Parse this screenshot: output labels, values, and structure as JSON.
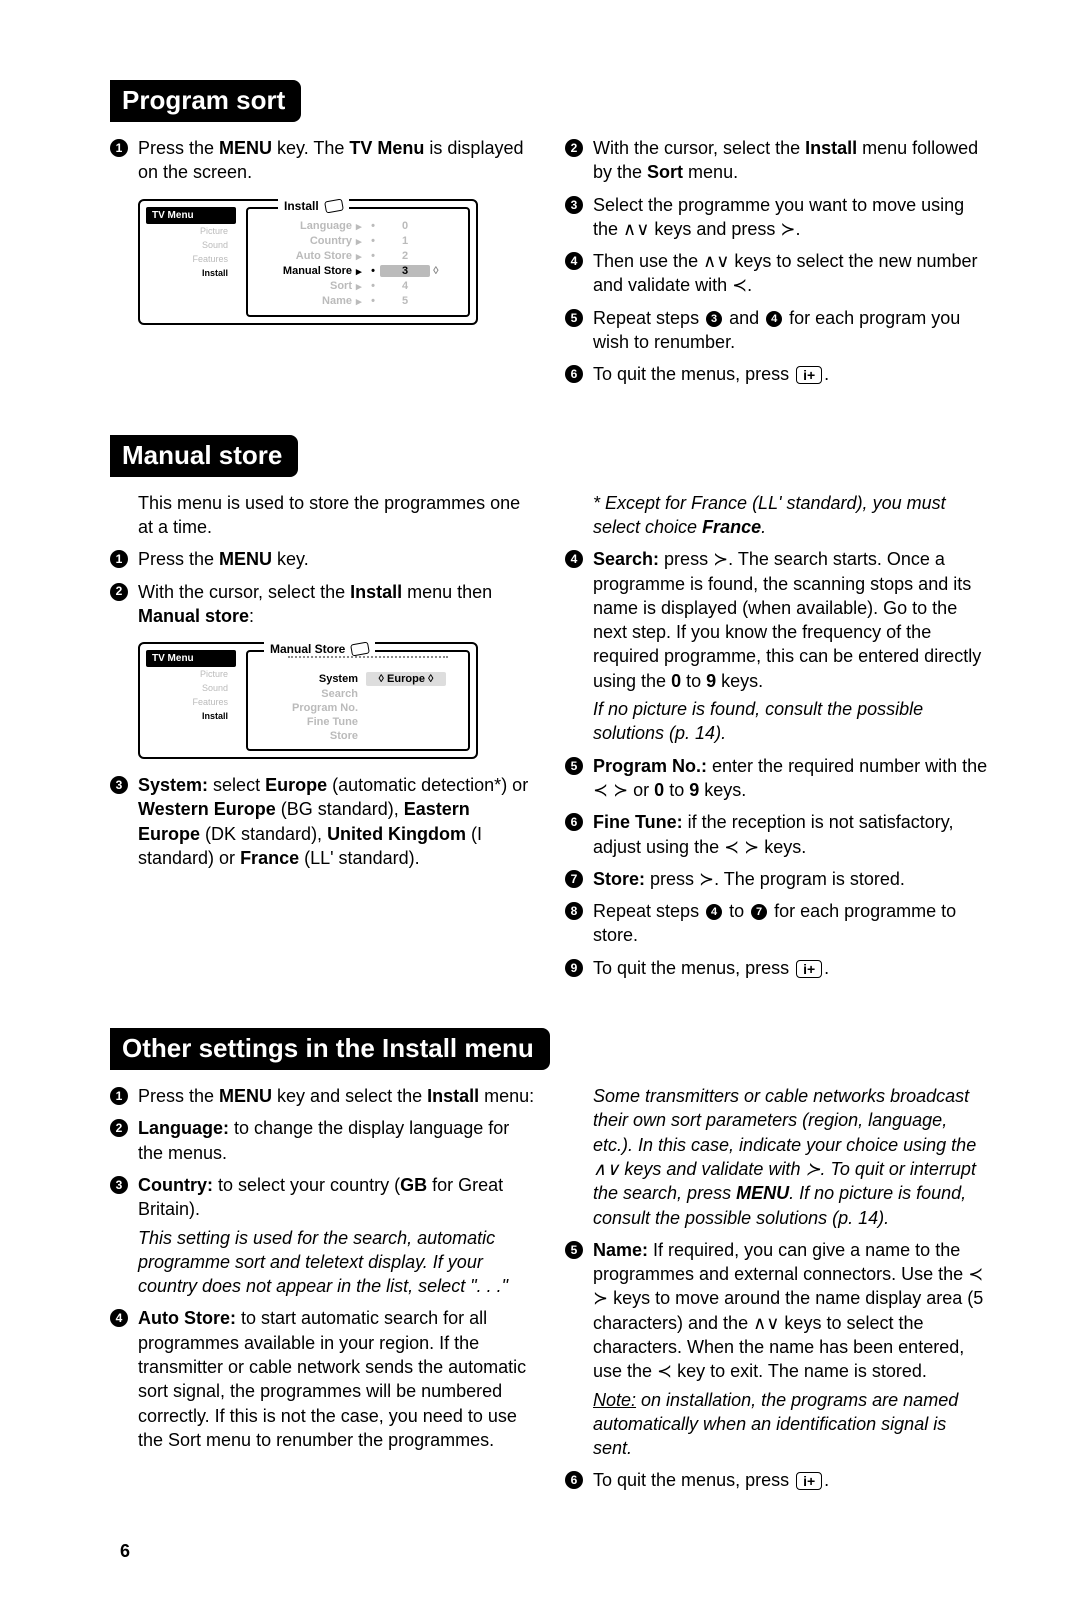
{
  "pageNumber": "6",
  "sections": {
    "program_sort": {
      "title": "Program sort",
      "left": {
        "step1_pre": "Press the ",
        "step1_key": "MENU",
        "step1_mid": " key. The ",
        "step1_tv": "TV Menu",
        "step1_post": " is displayed on the screen."
      },
      "figure": {
        "leftHeader": "TV Menu",
        "leftItems": [
          "Picture",
          "Sound",
          "Features",
          "Install"
        ],
        "rightHeader": "Install",
        "rows": [
          {
            "label": "Language",
            "num": "0"
          },
          {
            "label": "Country",
            "num": "1"
          },
          {
            "label": "Auto Store",
            "num": "2"
          },
          {
            "label": "Manual Store",
            "num": "3"
          },
          {
            "label": "Sort",
            "num": "4"
          },
          {
            "label": "Name",
            "num": "5"
          }
        ],
        "highlightIndex": 3
      },
      "right": {
        "step2_pre": "With the cursor, select the ",
        "step2_install": "Install",
        "step2_mid": " menu followed by the ",
        "step2_sort": "Sort",
        "step2_post": " menu.",
        "step3": "Select the programme you want to move using the ∧∨ keys and press ≻.",
        "step4": "Then use the ∧∨ keys to select the new number and validate with ≺.",
        "step5_pre": "Repeat steps ",
        "step5_post": " for each program you wish to renumber.",
        "step6": "To quit the menus, press "
      }
    },
    "manual_store": {
      "title": "Manual store",
      "left": {
        "intro": "This menu is used to store the programmes one at a time.",
        "step1_pre": "Press the ",
        "step1_key": "MENU",
        "step1_post": " key.",
        "step2_pre": "With the cursor, select the ",
        "step2_install": "Install",
        "step2_mid": " menu then ",
        "step2_ms": "Manual store",
        "step2_post": ":",
        "step3_pre": "System: ",
        "step3_select": "select ",
        "step3_europe": "Europe",
        "step3_auto": " (automatic detection*) or ",
        "step3_we": "Western Europe",
        "step3_bg": " (BG standard), ",
        "step3_ee": "Eastern Europe",
        "step3_dk": " (DK standard), ",
        "step3_uk": "United Kingdom",
        "step3_i": " (I standard) or ",
        "step3_fr": "France",
        "step3_ll": " (LL' standard)."
      },
      "figure": {
        "leftHeader": "TV Menu",
        "leftItems": [
          "Picture",
          "Sound",
          "Features",
          "Install"
        ],
        "rightHeader": "Manual Store",
        "rows": [
          {
            "label": "System",
            "val": "Europe"
          },
          {
            "label": "Search",
            "val": ""
          },
          {
            "label": "Program No.",
            "val": ""
          },
          {
            "label": "Fine Tune",
            "val": ""
          },
          {
            "label": "Store",
            "val": ""
          }
        ]
      },
      "right": {
        "note_pre": "* Except for France (LL' standard), you must select choice ",
        "note_fr": "France",
        "note_post": ".",
        "step4_pre": "Search: ",
        "step4_body": "press ≻. The search starts. Once a programme is found, the scanning stops and its name is displayed (when available). Go to the next step. If you know the frequency of the required programme, this can be entered directly using the ",
        "step4_0": "0",
        "step4_to": " to ",
        "step4_9": "9",
        "step4_keys": " keys.",
        "noPicture": "If no picture is found, consult the possible solutions (p. 14).",
        "step5_pre": "Program No.: ",
        "step5_body": "enter the required number with the ≺ ≻ or ",
        "step5_0": "0",
        "step5_to": " to ",
        "step5_9": "9",
        "step5_keys": " keys.",
        "step6_pre": "Fine Tune: ",
        "step6_body": "if the reception is not satisfactory, adjust using the ≺ ≻ keys.",
        "step7_pre": "Store: ",
        "step7_body": "press ≻. The program is stored.",
        "step8_pre": "Repeat steps ",
        "step8_post": " for each programme to store.",
        "step9": "To quit the menus, press "
      }
    },
    "other": {
      "title": "Other settings in the Install menu",
      "left": {
        "step1_pre": "Press the ",
        "step1_key": "MENU",
        "step1_mid": " key and select the ",
        "step1_install": "Install",
        "step1_post": " menu:",
        "step2_pre": "Language: ",
        "step2_body": "to change the display language for the menus.",
        "step3_pre": "Country: ",
        "step3_body": "to select your country (",
        "step3_gb": "GB",
        "step3_post": " for Great Britain).",
        "step3_note": "This setting is used for the search, automatic programme sort and teletext display. If your country does not appear in the list, select \". . .\"",
        "step4_pre": "Auto Store: ",
        "step4_body": "to start automatic search for all programmes available in your region. If the transmitter or cable network sends the automatic sort signal, the programmes will be numbered correctly. If this is not the case, you need to use the Sort menu to renumber the programmes."
      },
      "right": {
        "note": "Some transmitters or cable networks broadcast their own sort parameters (region, language, etc.). In this case, indicate your choice using the ∧∨ keys and validate with ≻. To quit or interrupt the search, press ",
        "menuKey": "MENU",
        "notePost": ". If no picture is found, consult the possible solutions (p. 14).",
        "step5_pre": "Name: ",
        "step5_body": "If required, you can give a name to the programmes and external connectors. Use the ≺ ≻ keys to move around the name display area (5 characters) and the ∧∨ keys to select the characters. When the name has been entered, use the ≺ key to exit. The name is stored.",
        "step5_note_pre": "Note:",
        "step5_note": " on installation, the programs are named automatically when an identification signal is sent.",
        "step6": "To quit the menus, press "
      }
    }
  },
  "glyphs": {
    "up": "∧",
    "down": "∨",
    "left": "≺",
    "right": "≻",
    "info": "i+"
  }
}
